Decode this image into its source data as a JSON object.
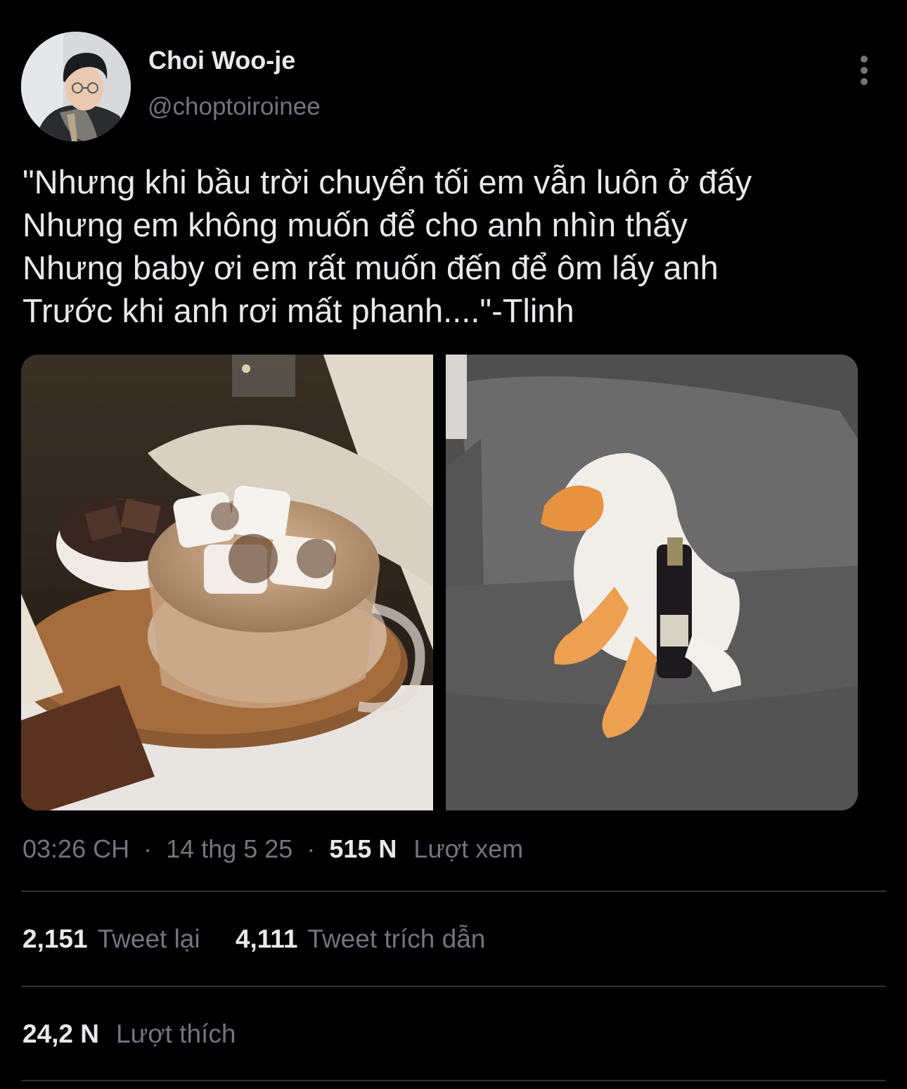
{
  "author": {
    "display_name": "Choi Woo-je",
    "handle": "@choptoiroinee"
  },
  "tweet": {
    "lines": [
      "\"Nhưng khi bầu trời chuyển tối em vẫn luôn ở đấy",
      "Nhưng em không muốn để cho anh nhìn thấy",
      "Nhưng baby ơi em rất muốn đến để ôm lấy anh",
      "Trước khi anh rơi mất phanh....\"-Tlinh"
    ]
  },
  "media": [
    {
      "name": "hot-chocolate-marshmallow-photo"
    },
    {
      "name": "plush-goose-with-wine-photo"
    }
  ],
  "meta": {
    "time": "03:26 CH",
    "date": "14 thg 5 25",
    "views_count": "515 N",
    "views_label": "Lượt xem",
    "separator": "·"
  },
  "stats": {
    "retweets_count": "2,151",
    "retweets_label": "Tweet lại",
    "quotes_count": "4,111",
    "quotes_label": "Tweet trích dẫn",
    "likes_count": "24,2 N",
    "likes_label": "Lượt thích"
  },
  "icons": {
    "more": "more-vertical-icon"
  },
  "colors": {
    "background": "#000000",
    "primary_text": "#e7e9ea",
    "secondary_text": "#71767b",
    "divider": "#2f3336"
  }
}
